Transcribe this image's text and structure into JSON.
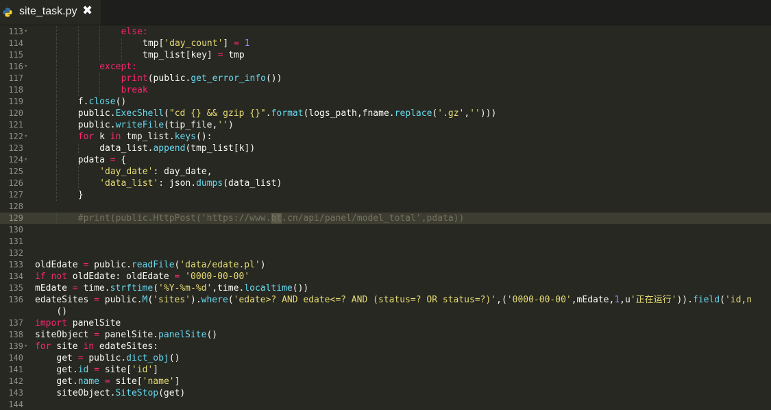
{
  "tab": {
    "filename": "site_task.py",
    "close_glyph": "✖",
    "icon": "python-icon"
  },
  "colors": {
    "background": "#272822",
    "keyword": "#f92672",
    "function": "#66d9ef",
    "string": "#e6db74",
    "number": "#ae81ff",
    "comment": "#75715e"
  },
  "editor": {
    "active_line": 129,
    "lines": [
      {
        "n": "113",
        "fold": true
      },
      {
        "n": "114"
      },
      {
        "n": "115"
      },
      {
        "n": "116",
        "fold": true
      },
      {
        "n": "117"
      },
      {
        "n": "118"
      },
      {
        "n": "119"
      },
      {
        "n": "120"
      },
      {
        "n": "121"
      },
      {
        "n": "122",
        "fold": true
      },
      {
        "n": "123"
      },
      {
        "n": "124",
        "fold": true
      },
      {
        "n": "125"
      },
      {
        "n": "126"
      },
      {
        "n": "127"
      },
      {
        "n": "128"
      },
      {
        "n": "129"
      },
      {
        "n": "130"
      },
      {
        "n": "131"
      },
      {
        "n": "132"
      },
      {
        "n": "133"
      },
      {
        "n": "134"
      },
      {
        "n": "135"
      },
      {
        "n": "136"
      },
      {
        "n": ""
      },
      {
        "n": "137"
      },
      {
        "n": "138"
      },
      {
        "n": "139",
        "fold": true
      },
      {
        "n": "140"
      },
      {
        "n": "141"
      },
      {
        "n": "142"
      },
      {
        "n": "143"
      },
      {
        "n": "144"
      }
    ],
    "code": {
      "l113": "else:",
      "l114_a": "tmp[",
      "l114_s": "'day_count'",
      "l114_b": "] ",
      "l114_op": "=",
      "l114_sp": " ",
      "l114_n": "1",
      "l115": "tmp_list[key] ",
      "l115_op": "=",
      "l115_b": " tmp",
      "l116": "except:",
      "l117_kw": "print",
      "l117_a": "(public.",
      "l117_fn": "get_error_info",
      "l117_b": "())",
      "l118": "break",
      "l119_a": "f.",
      "l119_fn": "close",
      "l119_b": "()",
      "l120_a": "public.",
      "l120_fn": "ExecShell",
      "l120_b": "(",
      "l120_s": "\"cd {} && gzip {}\"",
      "l120_c": ".",
      "l120_fn2": "format",
      "l120_d": "(logs_path,fname.",
      "l120_fn3": "replace",
      "l120_e": "(",
      "l120_s2": "'.gz'",
      "l120_f": ",",
      "l120_s3": "''",
      "l120_g": ")))",
      "l121_a": "public.",
      "l121_fn": "writeFile",
      "l121_b": "(tip_file,",
      "l121_s": "''",
      "l121_c": ")",
      "l122_kw": "for",
      "l122_a": " k ",
      "l122_kw2": "in",
      "l122_b": " tmp_list.",
      "l122_fn": "keys",
      "l122_c": "():",
      "l123_a": "data_list.",
      "l123_fn": "append",
      "l123_b": "(tmp_list[k])",
      "l124_a": "pdata ",
      "l124_op": "=",
      "l124_b": " {",
      "l125_s": "'day_date'",
      "l125_a": ": day_date,",
      "l126_s": "'data_list'",
      "l126_a": ": json.",
      "l126_fn": "dumps",
      "l126_b": "(data_list)",
      "l127": "}",
      "l129_a": "#print(public.HttpPost('https://www.",
      "l129_hl": "bt",
      "l129_b": ".cn/api/panel/model_total',pdata))",
      "l133_a": "oldEdate ",
      "l133_op": "=",
      "l133_b": " public.",
      "l133_fn": "readFile",
      "l133_c": "(",
      "l133_s": "'data/edate.pl'",
      "l133_d": ")",
      "l134_kw": "if not",
      "l134_a": " oldEdate: oldEdate ",
      "l134_op": "=",
      "l134_sp": " ",
      "l134_s": "'0000-00-00'",
      "l135_a": "mEdate ",
      "l135_op": "=",
      "l135_b": " time.",
      "l135_fn": "strftime",
      "l135_c": "(",
      "l135_s": "'%Y-%m-%d'",
      "l135_d": ",time.",
      "l135_fn2": "localtime",
      "l135_e": "())",
      "l136_a": "edateSites ",
      "l136_op": "=",
      "l136_b": " public.",
      "l136_fn": "M",
      "l136_c": "(",
      "l136_s": "'sites'",
      "l136_d": ").",
      "l136_fn2": "where",
      "l136_e": "(",
      "l136_s2": "'edate>? AND edate<=? AND (status=? OR status=?)'",
      "l136_f": ",(",
      "l136_s3": "'0000-00-00'",
      "l136_g": ",mEdate,",
      "l136_n": "1",
      "l136_h": ",u",
      "l136_s4": "'正在运行'",
      "l136_i": ")).",
      "l136_fn3": "field",
      "l136_j": "(",
      "l136_s5": "'id,n",
      "l136w": "()",
      "l137_kw": "import",
      "l137_a": " panelSite",
      "l138_a": "siteObject ",
      "l138_op": "=",
      "l138_b": " panelSite.",
      "l138_fn": "panelSite",
      "l138_c": "()",
      "l139_kw": "for",
      "l139_a": " site ",
      "l139_kw2": "in",
      "l139_b": " edateSites:",
      "l140_a": "get ",
      "l140_op": "=",
      "l140_b": " public.",
      "l140_fn": "dict_obj",
      "l140_c": "()",
      "l141_a": "get.",
      "l141_fn": "id",
      "l141_b": " ",
      "l141_op": "=",
      "l141_c": " site[",
      "l141_s": "'id'",
      "l141_d": "]",
      "l142_a": "get.",
      "l142_fn": "name",
      "l142_b": " ",
      "l142_op": "=",
      "l142_c": " site[",
      "l142_s": "'name'",
      "l142_d": "]",
      "l143_a": "siteObject.",
      "l143_fn": "SiteStop",
      "l143_b": "(get)"
    }
  }
}
